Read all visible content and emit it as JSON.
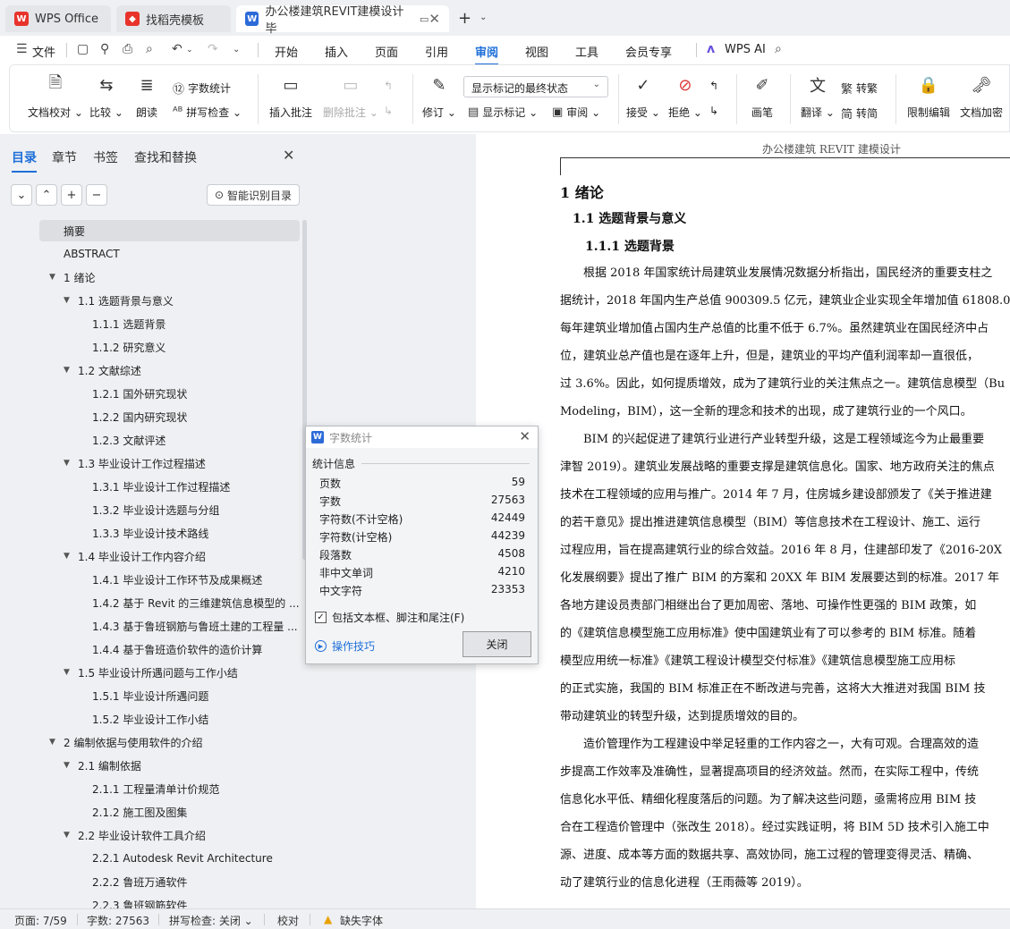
{
  "tabs": [
    {
      "label": "WPS Office",
      "icon": "wps-logo-icon"
    },
    {
      "label": "找稻壳模板",
      "icon": "docer-icon"
    },
    {
      "label": "办公楼建筑REVIT建模设计 毕",
      "icon": "word-doc-icon"
    }
  ],
  "menubar": {
    "file_label": "文件",
    "items": [
      "开始",
      "插入",
      "页面",
      "引用",
      "审阅",
      "视图",
      "工具",
      "会员专享"
    ],
    "active": "审阅",
    "wps_ai": "WPS AI"
  },
  "ribbon": {
    "doc_proofread": "文档校对",
    "compare": "比较",
    "read_aloud": "朗读",
    "word_count": "字数统计",
    "spell_check": "拼写检查",
    "insert_comment": "插入批注",
    "delete_comment": "删除批注",
    "revise": "修订",
    "markup_state": "显示标记的最终状态",
    "show_markup": "显示标记",
    "review": "审阅",
    "accept": "接受",
    "reject": "拒绝",
    "pen": "画笔",
    "translate": "翻译",
    "to_traditional": "转繁",
    "to_simplified": "转简",
    "restrict_edit": "限制编辑",
    "encrypt": "文档加密"
  },
  "nav": {
    "tabs": [
      "目录",
      "章节",
      "书签",
      "查找和替换"
    ],
    "active_tab": "目录",
    "smart_toc": "智能识别目录",
    "toc": [
      {
        "label": "摘要",
        "level": 0,
        "selected": true
      },
      {
        "label": "ABSTRACT",
        "level": 0
      },
      {
        "label": "1 绪论",
        "level": 0,
        "expand": true
      },
      {
        "label": "1.1 选题背景与意义",
        "level": 1,
        "expand": true
      },
      {
        "label": "1.1.1 选题背景",
        "level": 2
      },
      {
        "label": "1.1.2 研究意义",
        "level": 2
      },
      {
        "label": "1.2 文献综述",
        "level": 1,
        "expand": true
      },
      {
        "label": "1.2.1  国外研究现状",
        "level": 2
      },
      {
        "label": "1.2.2  国内研究现状",
        "level": 2
      },
      {
        "label": "1.2.3  文献评述",
        "level": 2
      },
      {
        "label": "1.3 毕业设计工作过程描述",
        "level": 1,
        "expand": true
      },
      {
        "label": "1.3.1 毕业设计工作过程描述",
        "level": 2
      },
      {
        "label": "1.3.2 毕业设计选题与分组",
        "level": 2
      },
      {
        "label": "1.3.3 毕业设计技术路线",
        "level": 2
      },
      {
        "label": "1.4 毕业设计工作内容介绍",
        "level": 1,
        "expand": true
      },
      {
        "label": "1.4.1 毕业设计工作环节及成果概述",
        "level": 2
      },
      {
        "label": "1.4.2 基于 Revit 的三维建筑信息模型的 ...",
        "level": 2
      },
      {
        "label": "1.4.3 基于鲁班钢筋与鲁班土建的工程量 ...",
        "level": 2
      },
      {
        "label": "1.4.4 基于鲁班造价软件的造价计算",
        "level": 2
      },
      {
        "label": "1.5 毕业设计所遇问题与工作小结",
        "level": 1,
        "expand": true
      },
      {
        "label": "1.5.1 毕业设计所遇问题",
        "level": 2
      },
      {
        "label": "1.5.2 毕业设计工作小结",
        "level": 2
      },
      {
        "label": "2 编制依据与使用软件的介绍",
        "level": 0,
        "expand": true
      },
      {
        "label": "2.1 编制依据",
        "level": 1,
        "expand": true
      },
      {
        "label": "2.1.1 工程量清单计价规范",
        "level": 2
      },
      {
        "label": "2.1.2 施工图及图集",
        "level": 2
      },
      {
        "label": "2.2 毕业设计软件工具介绍",
        "level": 1,
        "expand": true
      },
      {
        "label": "2.2.1 Autodesk Revit Architecture",
        "level": 2
      },
      {
        "label": "2.2.2 鲁班万通软件",
        "level": 2
      },
      {
        "label": "2.2.3 鲁班钢筋软件",
        "level": 2
      }
    ]
  },
  "doc": {
    "header": "办公楼建筑 REVIT 建模设计",
    "h1": "1 绪论",
    "h2": "1.1 选题背景与意义",
    "h3": "1.1.1 选题背景",
    "lines": [
      "　　根据 2018 年国家统计局建筑业发展情况数据分析指出，国民经济的重要支柱之",
      "据统计，2018 年国内生产总值 900309.5 亿元，建筑业企业实现全年增加值 61808.0",
      "每年建筑业增加值占国内生产总值的比重不低于 6.7%。虽然建筑业在国民经济中占",
      "位，建筑业总产值也是在逐年上升，但是，建筑业的平均产值利润率却一直很低，",
      "过 3.6%。因此，如何提质增效，成为了建筑行业的关注焦点之一。建筑信息模型（Bu",
      "Modeling，BIM），这一全新的理念和技术的出现，成了建筑行业的一个风口。",
      "　　BIM 的兴起促进了建筑行业进行产业转型升级，这是工程领域迄今为止最重要",
      "津智 2019）。建筑业发展战略的重要支撑是建筑信息化。国家、地方政府关注的焦点",
      "技术在工程领域的应用与推广。2014 年 7 月，住房城乡建设部颁发了《关于推进建",
      "的若干意见》提出推进建筑信息模型（BIM）等信息技术在工程设计、施工、运行",
      "过程应用，旨在提高建筑行业的综合效益。2016 年 8 月，住建部印发了《2016-20X",
      "化发展纲要》提出了推广 BIM 的方案和 20XX 年 BIM 发展要达到的标准。2017 年",
      "各地方建设员责部门相继出台了更加周密、落地、可操作性更强的  BIM 政策，如",
      "的《建筑信息模型施工应用标准》使中国建筑业有了可以参考的 BIM 标准。随着",
      "模型应用统一标准》《建筑工程设计模型交付标准》《建筑信息模型施工应用标",
      "的正式实施，我国的 BIM 标准正在不断改进与完善，这将大大推进对我国 BIM 技",
      "带动建筑业的转型升级，达到提质增效的目的。",
      "　　造价管理作为工程建设中举足轻重的工作内容之一，大有可观。合理高效的造",
      "步提高工作效率及准确性，显著提高项目的经济效益。然而，在实际工程中，传统",
      "信息化水平低、精细化程度落后的问题。为了解决这些问题，亟需将应用  BIM  技",
      "合在工程造价管理中（张改生  2018）。经过实践证明，将  BIM 5D 技术引入施工中",
      "源、进度、成本等方面的数据共享、高效协同，施工过程的管理变得灵活、精确、",
      "动了建筑行业的信息化进程（王雨薇等  2019）。"
    ]
  },
  "dialog": {
    "title": "字数统计",
    "section": "统计信息",
    "stats": [
      {
        "label": "页数",
        "value": "59"
      },
      {
        "label": "字数",
        "value": "27563"
      },
      {
        "label": "字符数(不计空格)",
        "value": "42449"
      },
      {
        "label": "字符数(计空格)",
        "value": "44239"
      },
      {
        "label": "段落数",
        "value": "4508"
      },
      {
        "label": "非中文单词",
        "value": "4210"
      },
      {
        "label": "中文字符",
        "value": "23353"
      }
    ],
    "checkbox_label": "包括文本框、脚注和尾注(F)",
    "checkbox_checked": true,
    "tips": "操作技巧",
    "close": "关闭"
  },
  "status": {
    "page": "页面: 7/59",
    "words": "字数: 27563",
    "spell": "拼写检查: 关闭",
    "proofread": "校对",
    "missing_font": "缺失字体"
  },
  "colors": {
    "accent": "#1e6fd9",
    "wps_red": "#e8332b",
    "word_blue": "#2c6bd8"
  }
}
